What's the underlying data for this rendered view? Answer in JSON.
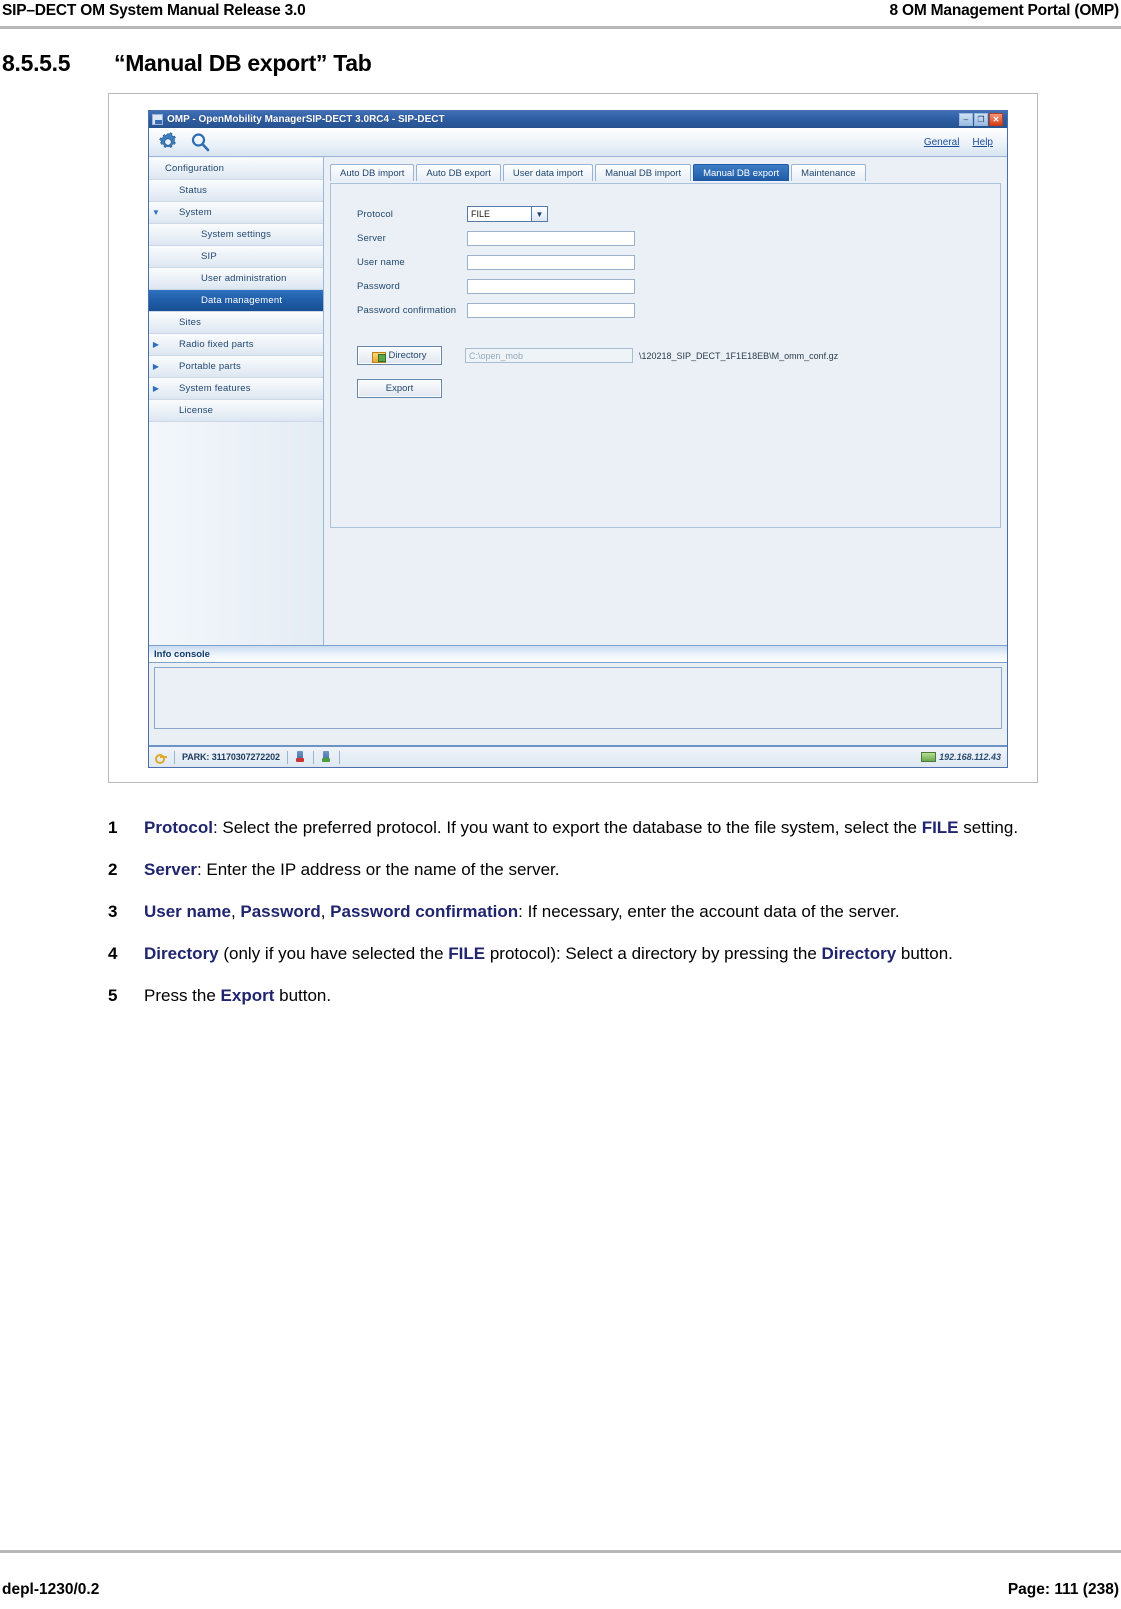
{
  "header": {
    "left": "SIP–DECT OM System Manual Release 3.0",
    "right": "8 OM Management Portal (OMP)"
  },
  "section": {
    "number": "8.5.5.5",
    "title": "“Manual DB export” Tab"
  },
  "app": {
    "titlebar": {
      "title": "OMP - OpenMobility ManagerSIP-DECT 3.0RC4 - SIP-DECT",
      "minimize": "–",
      "maximize": "❐",
      "close": "✕"
    },
    "toolbar": {
      "settings_icon": "gear-icon",
      "search_icon": "search-icon",
      "links": [
        "General",
        "Help"
      ]
    },
    "sidebar": {
      "items": [
        {
          "label": "Configuration",
          "indent": 0,
          "arrow": "",
          "selected": false
        },
        {
          "label": "Status",
          "indent": 1,
          "arrow": "",
          "selected": false
        },
        {
          "label": "System",
          "indent": 1,
          "arrow": "▼",
          "selected": false
        },
        {
          "label": "System settings",
          "indent": 2,
          "arrow": "",
          "selected": false
        },
        {
          "label": "SIP",
          "indent": 2,
          "arrow": "",
          "selected": false
        },
        {
          "label": "User administration",
          "indent": 2,
          "arrow": "",
          "selected": false
        },
        {
          "label": "Data management",
          "indent": 2,
          "arrow": "",
          "selected": true
        },
        {
          "label": "Sites",
          "indent": 1,
          "arrow": "",
          "selected": false
        },
        {
          "label": "Radio fixed parts",
          "indent": 1,
          "arrow": "▶",
          "selected": false
        },
        {
          "label": "Portable parts",
          "indent": 1,
          "arrow": "▶",
          "selected": false
        },
        {
          "label": "System features",
          "indent": 1,
          "arrow": "▶",
          "selected": false
        },
        {
          "label": "License",
          "indent": 1,
          "arrow": "",
          "selected": false
        }
      ]
    },
    "tabs": [
      {
        "label": "Auto DB import",
        "active": false
      },
      {
        "label": "Auto DB export",
        "active": false
      },
      {
        "label": "User data import",
        "active": false
      },
      {
        "label": "Manual DB import",
        "active": false
      },
      {
        "label": "Manual DB export",
        "active": true
      },
      {
        "label": "Maintenance",
        "active": false
      }
    ],
    "form": {
      "protocol": {
        "label": "Protocol",
        "value": "FILE",
        "arrow": "▼"
      },
      "server": {
        "label": "Server",
        "value": ""
      },
      "user_name": {
        "label": "User name",
        "value": ""
      },
      "password": {
        "label": "Password",
        "value": ""
      },
      "password_confirmation": {
        "label": "Password confirmation",
        "value": ""
      },
      "directory_button": "Directory",
      "directory_field_placeholder": "C:\\open_mob",
      "directory_file": "\\120218_SIP_DECT_1F1E18EB\\M_omm_conf.gz",
      "export_button": "Export"
    },
    "info_console": {
      "title": "Info console",
      "content": ""
    },
    "statusbar": {
      "park": "PARK: 31170307272202",
      "ip": "192.168.112.43"
    }
  },
  "steps": [
    {
      "num": "1",
      "parts": [
        {
          "t": "Protocol",
          "b": true
        },
        {
          "t": ": Select the preferred protocol. If you want to export the database to the file system, select the ",
          "b": false
        },
        {
          "t": "FILE",
          "b": true
        },
        {
          "t": " setting.",
          "b": false
        }
      ]
    },
    {
      "num": "2",
      "parts": [
        {
          "t": "Server",
          "b": true
        },
        {
          "t": ": Enter the IP address or the name of the server.",
          "b": false
        }
      ]
    },
    {
      "num": "3",
      "parts": [
        {
          "t": "User name",
          "b": true
        },
        {
          "t": ", ",
          "b": false
        },
        {
          "t": "Password",
          "b": true
        },
        {
          "t": ", ",
          "b": false
        },
        {
          "t": "Password confirmation",
          "b": true
        },
        {
          "t": ": If necessary, enter the account data of the server.",
          "b": false
        }
      ]
    },
    {
      "num": "4",
      "parts": [
        {
          "t": "Directory",
          "b": true
        },
        {
          "t": " (only if you have selected the ",
          "b": false
        },
        {
          "t": "FILE",
          "b": true
        },
        {
          "t": " protocol): Select a directory by pressing the ",
          "b": false
        },
        {
          "t": "Directory",
          "b": true
        },
        {
          "t": " button.",
          "b": false
        }
      ]
    },
    {
      "num": "5",
      "parts": [
        {
          "t": "Press the ",
          "b": false
        },
        {
          "t": "Export",
          "b": true
        },
        {
          "t": " button.",
          "b": false
        }
      ]
    }
  ],
  "footer": {
    "left": "depl-1230/0.2",
    "right": "Page: 111 (238)"
  },
  "colors": {
    "accent_blue": "#1f5ba4",
    "link_blue": "#20256e",
    "selected_row": "#1a4f93"
  }
}
